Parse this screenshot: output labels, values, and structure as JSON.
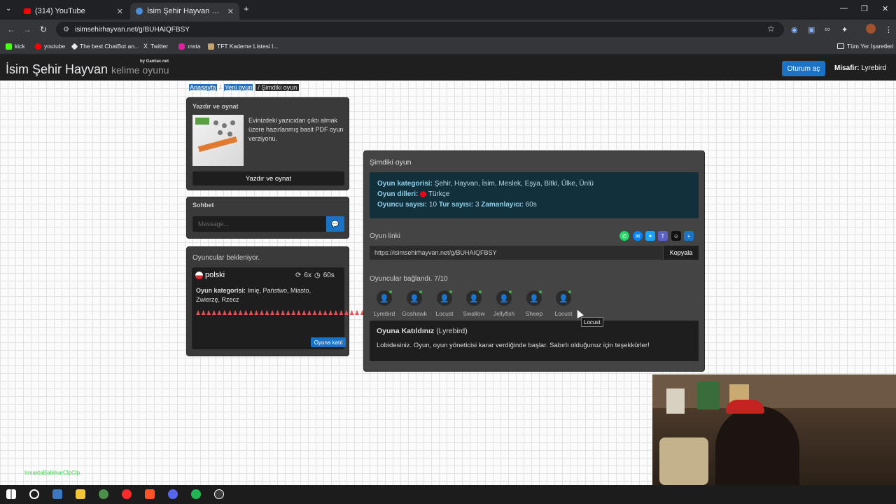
{
  "browser": {
    "tabs": [
      {
        "title": "(314) YouTube",
        "active": false
      },
      {
        "title": "İsim Şehir Hayvan oyununa katı",
        "active": true
      }
    ],
    "url": "isimsehirhayvan.net/g/BUHAIQFBSY",
    "bookmarks": [
      "kick",
      "youtube",
      "The best ChatBot an...",
      "Twitter",
      "ınsta",
      "TFT Kademe Listesi l..."
    ],
    "all_bookmarks": "Tüm Yer İşaretleri"
  },
  "site": {
    "brand_main": "İsim Şehir Hayvan",
    "brand_sub": "kelime oyunu",
    "by": "by Gamiac.net",
    "login": "Oturum aç",
    "guest_label": "Misafir:",
    "guest_name": "Lyrebird"
  },
  "breadcrumb": {
    "home": "Anasayfa",
    "sep": "/",
    "new": "Yeni oyun",
    "current": "Şimdiki oyun"
  },
  "print": {
    "heading": "Yazdır ve oynat",
    "text": "Evinizdeki yazıcıdan çıktı almak üzere hazırlanmış basit PDF oyun verziyonu.",
    "button": "Yazdır ve oynat"
  },
  "chat": {
    "heading": "Sohbet",
    "placeholder": "Message..."
  },
  "waiting": {
    "heading": "Oyuncular bekleniyor.",
    "lang": "polski",
    "rounds": "6x",
    "timer": "60s",
    "cat_label": "Oyun kategorisi:",
    "cat_value": "Imię, Państwo, Miasto, Zwierzę, Rzecz",
    "players_icons": "♟♟♟♟♟♟♟♟♟♟♟♟♟♟♟♟♟♟♟♟♟♟♟♟♟♟♟♟♟♟♟♟♟♟♟♟♟♟♟♟♟♟♟♟♟♟♟♟",
    "join": "Oyuna katıl"
  },
  "game": {
    "heading": "Şimdiki oyun",
    "cat_label": "Oyun kategorisi:",
    "cat_value": "Şehir, Hayvan, İsim, Meslek, Eşya, Bitki, Ülke, Ünlü",
    "lang_label": "Oyun dilleri:",
    "lang_value": "Türkçe",
    "players_label": "Oyuncu sayısı:",
    "players_value": "10",
    "rounds_label": "Tur sayısı:",
    "rounds_value": "3",
    "timer_label": "Zamanlayıcı:",
    "timer_value": "60s",
    "link_label": "Oyun linki",
    "link": "https://isimsehirhayvan.net/g/BUHAIQFBSY",
    "copy": "Kopyala",
    "connected": "Oyuncular bağlandı. 7/10",
    "players": [
      "Lyrebird",
      "Goshawk",
      "Locust",
      "Swallow",
      "Jellyfish",
      "Sheep",
      "Locust"
    ],
    "joined_title": "Oyuna Katıldınız",
    "joined_name": "(Lyrebird)",
    "joined_msg": "Lobidesiniz. Oyun, oyun yöneticisi karar verdiğinde başlar. Sabırlı olduğunuz için teşekkürler!",
    "tooltip": "Locust"
  },
  "overlay": {
    "chat_user": "IrmaktaBalikkarClpClp"
  }
}
